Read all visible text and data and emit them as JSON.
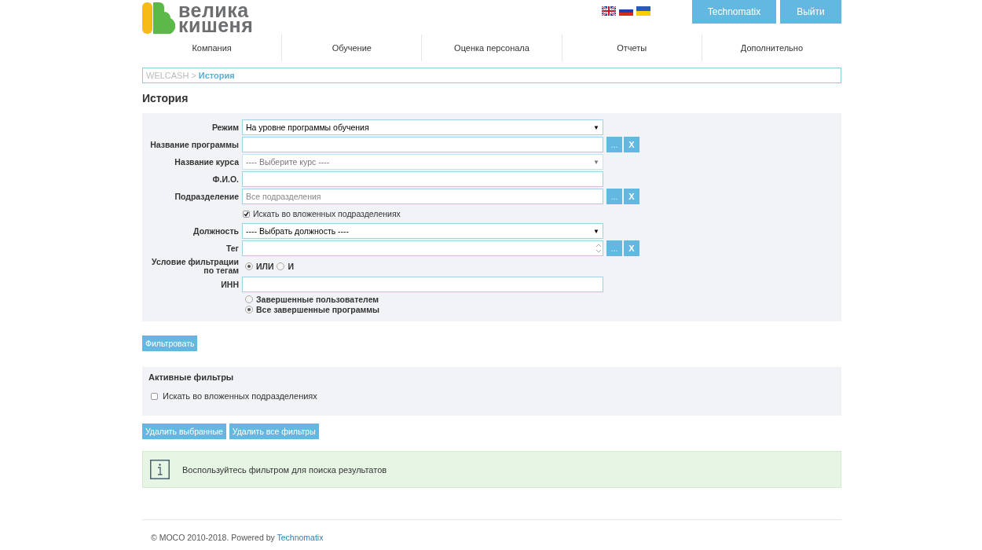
{
  "header": {
    "logo": [
      "велика",
      "кишеня"
    ],
    "buttons": [
      "Technomatix",
      "Выйти"
    ]
  },
  "nav": [
    {
      "label": "Компания"
    },
    {
      "label": "Обучение"
    },
    {
      "label": "Оценка персонала"
    },
    {
      "label": "Отчеты"
    },
    {
      "label": "Дополнительно"
    }
  ],
  "breadcrumb": {
    "root": "WELCASH",
    "separator": ">",
    "current": "История"
  },
  "page_title": "История",
  "form": {
    "rows": [
      {
        "kind": "select",
        "label": "Режим",
        "value": "На уровне программы обучения",
        "disabled": false,
        "arrow": "▼"
      },
      {
        "kind": "lookup",
        "label": "Название программы",
        "buttons": [
          "...",
          "X"
        ]
      },
      {
        "kind": "select",
        "label": "Название курса",
        "value": "---- Выберите курс ----",
        "disabled": true,
        "arrow": "▼"
      },
      {
        "kind": "input",
        "label": "Ф.И.О."
      },
      {
        "kind": "lookup",
        "label": "Подразделение",
        "placeholder": "Все подразделения",
        "buttons": [
          "...",
          "X"
        ]
      },
      {
        "kind": "checkbox",
        "label": "Искать во вложенных подразделениях",
        "checked": true
      },
      {
        "kind": "select",
        "label": "Должность",
        "value": "---- Выбрать должность ----",
        "disabled": false,
        "arrow": "▼"
      },
      {
        "kind": "tags",
        "label": "Тег",
        "buttons": [
          "...",
          "X"
        ]
      },
      {
        "kind": "radio-inline",
        "label": "Условие фильтрации по тегам",
        "options": [
          {
            "label": "ИЛИ",
            "selected": true
          },
          {
            "label": "И",
            "selected": false
          }
        ]
      },
      {
        "kind": "input",
        "label": "ИНН"
      },
      {
        "kind": "radio-list",
        "options": [
          {
            "label": "Завершенные пользователем",
            "selected": false
          },
          {
            "label": "Все завершенные программы",
            "selected": true
          }
        ]
      }
    ],
    "submit": "Фильтровать"
  },
  "active_filters": {
    "title": "Активные фильтры",
    "items": [
      {
        "label": "Искать во вложенных подразделениях",
        "checked": false
      }
    ],
    "buttons": [
      "Удалить выбранные",
      "Удалить все фильтры"
    ]
  },
  "info": {
    "message": "Воспользуйтесь фильтром для поиска результатов"
  },
  "footer": {
    "text": "© MOCO 2010-2018. Powered by",
    "link": "Technomatix"
  }
}
